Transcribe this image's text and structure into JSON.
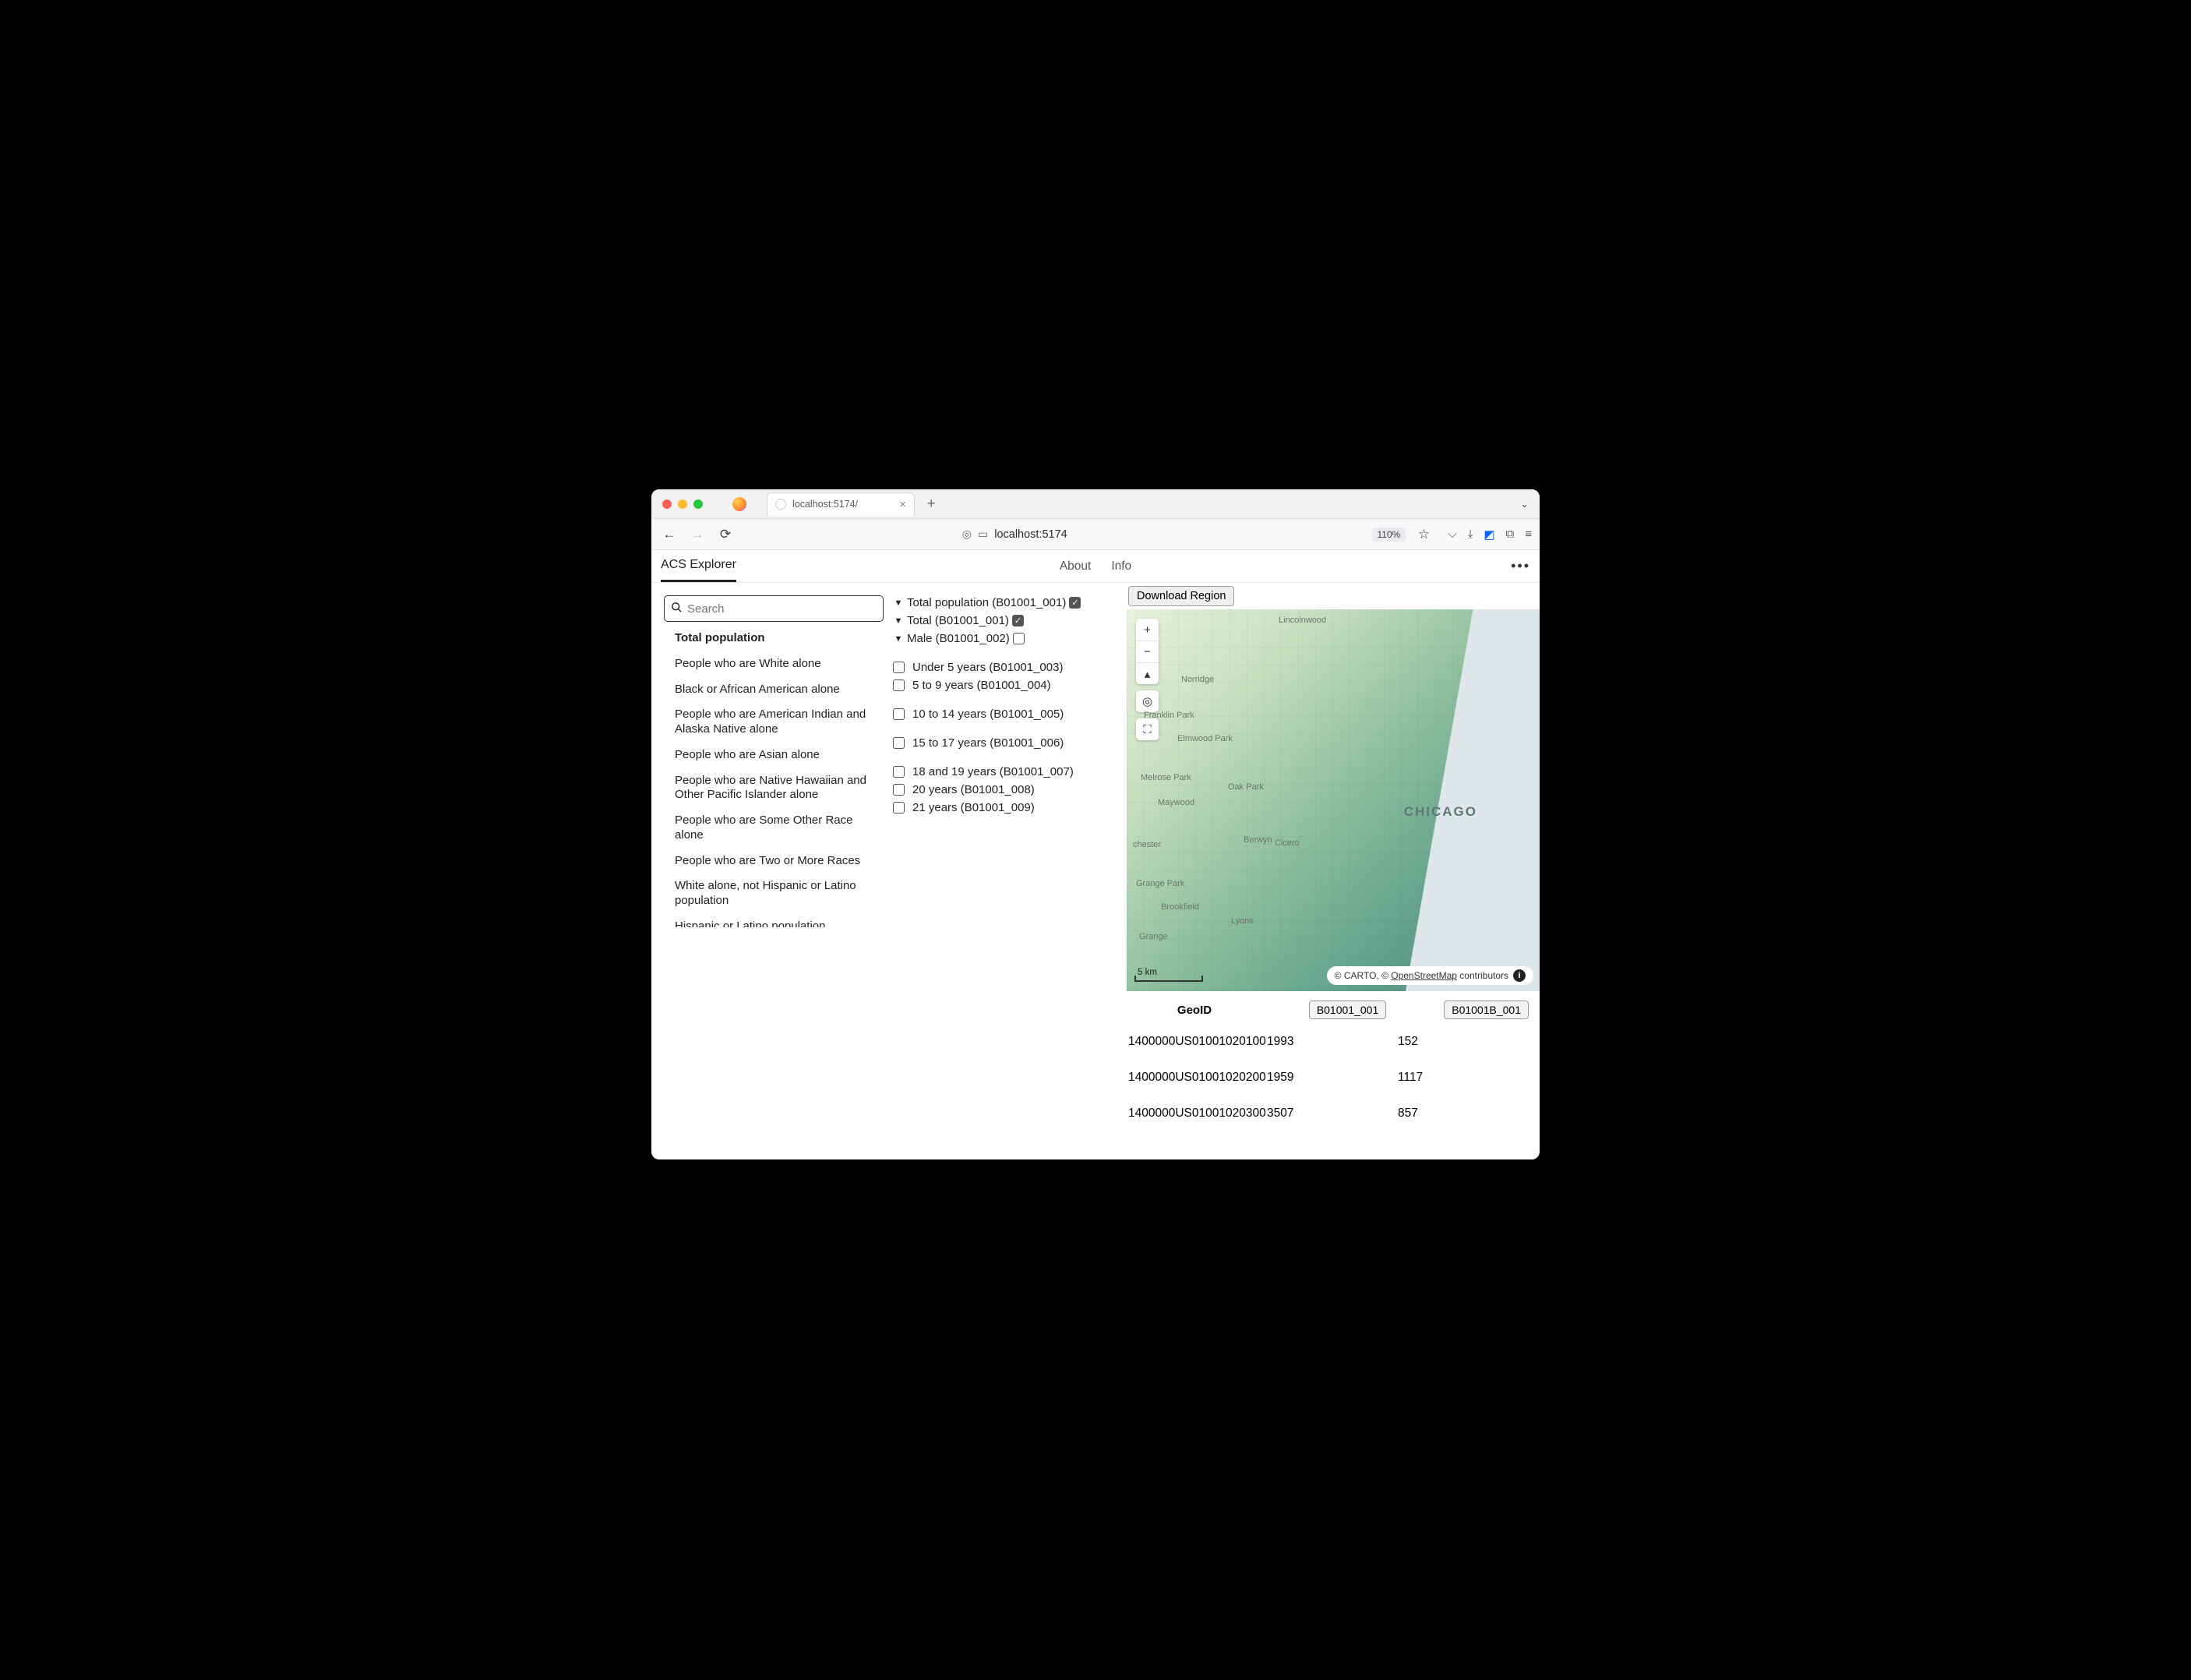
{
  "browser": {
    "tab_title": "localhost:5174/",
    "url": "localhost:5174",
    "zoom": "110%",
    "new_tab_plus": "+",
    "dropdown_chevron": "⌄"
  },
  "app": {
    "brand": "ACS Explorer",
    "nav": {
      "about": "About",
      "info": "Info"
    },
    "kebab": "•••"
  },
  "search": {
    "placeholder": "Search"
  },
  "categories": [
    "Total population",
    "People who are White alone",
    "Black or African American alone",
    "People who are American Indian and Alaska Native alone",
    "People who are Asian alone",
    "People who are Native Hawaiian and Other Pacific Islander alone",
    "People who are Some Other Race alone",
    "People who are Two or More Races",
    "White alone, not Hispanic or Latino population",
    "Hispanic or Latino population"
  ],
  "tree": {
    "n0": {
      "label": "Total population (B01001_001)",
      "checked": true
    },
    "n1": {
      "label": "Total (B01001_001)",
      "checked": true
    },
    "n2": {
      "label": "Male (B01001_002)",
      "checked": false
    },
    "leaves": [
      "Under 5 years (B01001_003)",
      "5 to 9 years (B01001_004)",
      "10 to 14 years (B01001_005)",
      "15 to 17 years (B01001_006)",
      "18 and 19 years (B01001_007)",
      "20 years (B01001_008)",
      "21 years (B01001_009)"
    ]
  },
  "download_label": "Download Region",
  "map": {
    "city": "CHICAGO",
    "labels": {
      "lincolnwood": "Lincolnwood",
      "norridge": "Norridge",
      "franklin": "Franklin Park",
      "elmwood": "Elmwood Park",
      "melrose": "Melrose Park",
      "oakpark": "Oak Park",
      "maywood": "Maywood",
      "berwyn": "Berwyn",
      "cicero": "Cicero",
      "chester": "chester",
      "orangepark": "Grange Park",
      "brookfield": "Brookfield",
      "lyons": "Lyons",
      "grange": "Grange"
    },
    "scale": "5 km",
    "attribution_prefix": "© CARTO, © ",
    "attribution_osm": "OpenStreetMap",
    "attribution_suffix": " contributors"
  },
  "table": {
    "headers": {
      "geo": "GeoID",
      "c1": "B01001_001",
      "c2": "B01001B_001"
    },
    "rows": [
      {
        "geo": "1400000US01001020100",
        "v1": "1993",
        "v2": "152"
      },
      {
        "geo": "1400000US01001020200",
        "v1": "1959",
        "v2": "1117"
      },
      {
        "geo": "1400000US01001020300",
        "v1": "3507",
        "v2": "857"
      }
    ]
  }
}
